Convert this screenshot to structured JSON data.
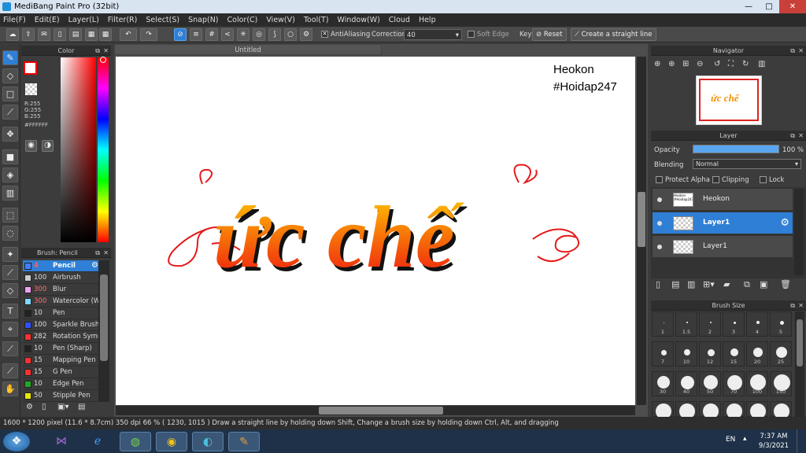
{
  "window": {
    "title": "MediBang Paint Pro (32bit)",
    "minimize": "—",
    "maximize": "□",
    "close": "✕"
  },
  "menu": [
    "File(F)",
    "Edit(E)",
    "Layer(L)",
    "Filter(R)",
    "Select(S)",
    "Snap(N)",
    "Color(C)",
    "View(V)",
    "Tool(T)",
    "Window(W)",
    "Cloud",
    "Help"
  ],
  "toolbar": {
    "antialiasing": "AntiAliasing",
    "correction_label": "Correction",
    "correction_value": "40",
    "soft_edge": "Soft Edge",
    "key_label": "Key",
    "reset": "Reset",
    "straight_line": "Create a straight line"
  },
  "color_panel": {
    "title": "Color",
    "r": "R:255",
    "g": "G:255",
    "b": "B:255",
    "hex": "#FFFFFF"
  },
  "brush_panel": {
    "title": "Brush: Pencil",
    "items": [
      {
        "size": "4",
        "name": "Pencil",
        "color": "#3f7fff"
      },
      {
        "size": "100",
        "name": "Airbrush",
        "color": "#cccccc"
      },
      {
        "size": "300",
        "name": "Blur",
        "color": "#f0a0f0"
      },
      {
        "size": "300",
        "name": "Watercolor (W",
        "color": "#80d8ff"
      },
      {
        "size": "10",
        "name": "Pen",
        "color": "#222222"
      },
      {
        "size": "100",
        "name": "Sparkle Brush",
        "color": "#3050ff"
      },
      {
        "size": "282",
        "name": "Rotation Symm",
        "color": "#ff3030"
      },
      {
        "size": "10",
        "name": "Pen (Sharp)",
        "color": "#222222"
      },
      {
        "size": "15",
        "name": "Mapping Pen",
        "color": "#ff3030"
      },
      {
        "size": "15",
        "name": "G Pen",
        "color": "#ff3030"
      },
      {
        "size": "10",
        "name": "Edge Pen",
        "color": "#22aa22"
      },
      {
        "size": "50",
        "name": "Stipple Pen",
        "color": "#e8e800"
      }
    ]
  },
  "document": {
    "tab": "Untitled",
    "watermark_line1": "Heokon",
    "watermark_line2": "#Hoidap247",
    "artwork_text": "ức chế",
    "colors": {
      "gradient_top": "#ffd000",
      "gradient_bottom": "#ee1010",
      "shadow": "#111111",
      "flourish": "#e51a1a"
    }
  },
  "navigator": {
    "title": "Navigator"
  },
  "layer_panel": {
    "title": "Layer",
    "opacity_label": "Opacity",
    "opacity_value": "100 %",
    "opacity_percent": 100,
    "blending_label": "Blending",
    "blending_value": "Normal",
    "protect_alpha": "Protect Alpha",
    "clipping": "Clipping",
    "lock": "Lock",
    "layers": [
      {
        "name": "Heokon",
        "thumb": "Heokon #Hoidap247"
      },
      {
        "name": "Layer1",
        "thumb": ""
      },
      {
        "name": "Layer1",
        "thumb": ""
      }
    ]
  },
  "brush_size_panel": {
    "title": "Brush Size",
    "row1": [
      "1",
      "1.5",
      "2",
      "3",
      "4",
      "5"
    ],
    "row2": [
      "7",
      "10",
      "12",
      "15",
      "20",
      "25"
    ],
    "row3": [
      "30",
      "40",
      "50",
      "70",
      "100",
      "150"
    ]
  },
  "statusbar": {
    "dimensions": "1600 * 1200 pixel",
    "physical": "(11.6 * 8.7cm)",
    "dpi": "350 dpi",
    "zoom": "66 %",
    "cursor": "( 1230, 1015 )",
    "hint": "Draw a straight line by holding down Shift, Change a brush size by holding down Ctrl, Alt, and dragging"
  },
  "taskbar": {
    "lang": "EN",
    "time": "7:37 AM",
    "date": "9/3/2021"
  }
}
